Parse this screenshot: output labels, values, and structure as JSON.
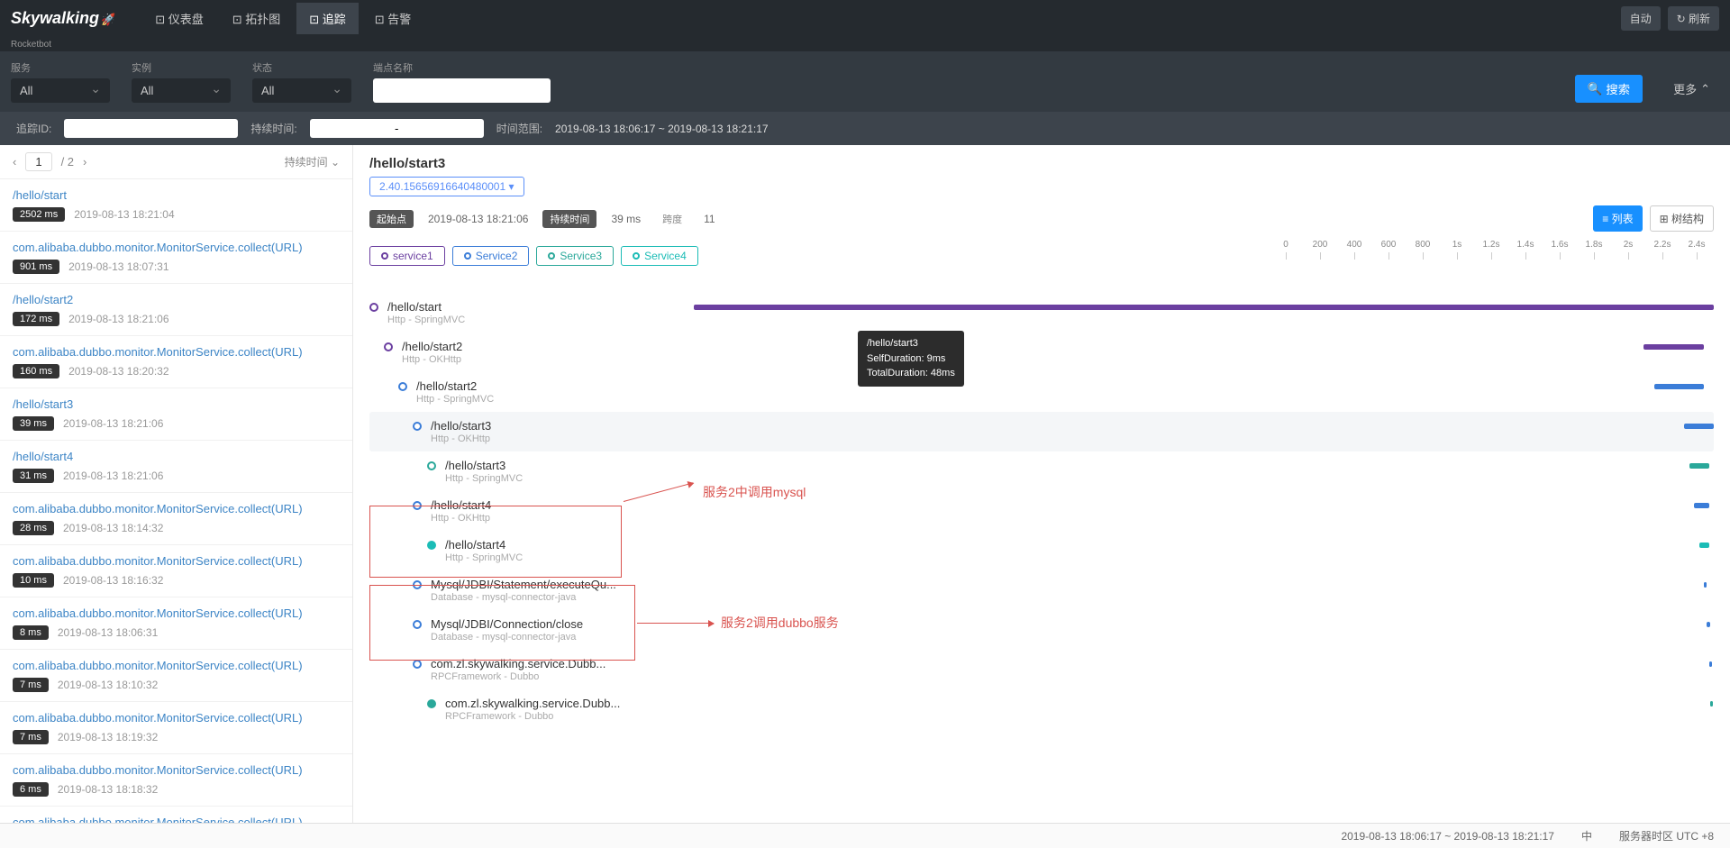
{
  "brand": {
    "name": "Skywalking",
    "sub": "Rocketbot"
  },
  "nav": [
    {
      "label": "仪表盘"
    },
    {
      "label": "拓扑图"
    },
    {
      "label": "追踪",
      "active": true
    },
    {
      "label": "告警"
    }
  ],
  "headerBtns": {
    "auto": "自动",
    "refresh": "刷新"
  },
  "filters": {
    "serviceLabel": "服务",
    "serviceVal": "All",
    "instanceLabel": "实例",
    "instanceVal": "All",
    "statusLabel": "状态",
    "statusVal": "All",
    "endpointLabel": "端点名称",
    "endpointVal": "",
    "searchLabel": "搜索",
    "moreLabel": "更多"
  },
  "subFilter": {
    "traceIdLabel": "追踪ID:",
    "traceIdVal": "",
    "durationLabel": "持续时间:",
    "durationVal": "-",
    "rangeLabel": "时间范围:",
    "rangeVal": "2019-08-13 18:06:17 ~ 2019-08-13 18:21:17"
  },
  "pager": {
    "cur": "1",
    "total": "/ 2",
    "sort": "持续时间"
  },
  "traceList": [
    {
      "name": "/hello/start",
      "dur": "2502 ms",
      "ts": "2019-08-13 18:21:04"
    },
    {
      "name": "com.alibaba.dubbo.monitor.MonitorService.collect(URL)",
      "dur": "901 ms",
      "ts": "2019-08-13 18:07:31"
    },
    {
      "name": "/hello/start2",
      "dur": "172 ms",
      "ts": "2019-08-13 18:21:06"
    },
    {
      "name": "com.alibaba.dubbo.monitor.MonitorService.collect(URL)",
      "dur": "160 ms",
      "ts": "2019-08-13 18:20:32"
    },
    {
      "name": "/hello/start3",
      "dur": "39 ms",
      "ts": "2019-08-13 18:21:06"
    },
    {
      "name": "/hello/start4",
      "dur": "31 ms",
      "ts": "2019-08-13 18:21:06"
    },
    {
      "name": "com.alibaba.dubbo.monitor.MonitorService.collect(URL)",
      "dur": "28 ms",
      "ts": "2019-08-13 18:14:32"
    },
    {
      "name": "com.alibaba.dubbo.monitor.MonitorService.collect(URL)",
      "dur": "10 ms",
      "ts": "2019-08-13 18:16:32"
    },
    {
      "name": "com.alibaba.dubbo.monitor.MonitorService.collect(URL)",
      "dur": "8 ms",
      "ts": "2019-08-13 18:06:31"
    },
    {
      "name": "com.alibaba.dubbo.monitor.MonitorService.collect(URL)",
      "dur": "7 ms",
      "ts": "2019-08-13 18:10:32"
    },
    {
      "name": "com.alibaba.dubbo.monitor.MonitorService.collect(URL)",
      "dur": "7 ms",
      "ts": "2019-08-13 18:19:32"
    },
    {
      "name": "com.alibaba.dubbo.monitor.MonitorService.collect(URL)",
      "dur": "6 ms",
      "ts": "2019-08-13 18:18:32"
    },
    {
      "name": "com.alibaba.dubbo.monitor.MonitorService.collect(URL)",
      "dur": "",
      "ts": ""
    }
  ],
  "trace": {
    "title": "/hello/start3",
    "id": "2.40.15656916640480001",
    "startLabel": "起始点",
    "startVal": "2019-08-13 18:21:06",
    "durLabel": "持续时间",
    "durVal": "39 ms",
    "spanLabel": "跨度",
    "spanVal": "11",
    "listBtn": "列表",
    "treeBtn": "树结构"
  },
  "services": [
    {
      "name": "service1",
      "color": "purple"
    },
    {
      "name": "Service2",
      "color": "blue"
    },
    {
      "name": "Service3",
      "color": "teal"
    },
    {
      "name": "Service4",
      "color": "cyan"
    }
  ],
  "scale": [
    "0",
    "200",
    "400",
    "600",
    "800",
    "1s",
    "1.2s",
    "1.4s",
    "1.6s",
    "1.8s",
    "2s",
    "2.2s",
    "2.4s"
  ],
  "spans": [
    {
      "indent": 0,
      "name": "/hello/start",
      "sub": "Http - SpringMVC",
      "color": "purple",
      "open": true,
      "barL": 0,
      "barW": 100,
      "barC": "purple"
    },
    {
      "indent": 1,
      "name": "/hello/start2",
      "sub": "Http - OKHttp",
      "color": "purple",
      "open": true,
      "barL": 93,
      "barW": 6,
      "barC": "purple"
    },
    {
      "indent": 2,
      "name": "/hello/start2",
      "sub": "Http - SpringMVC",
      "color": "blue",
      "open": true,
      "barL": 94,
      "barW": 5,
      "barC": "blue"
    },
    {
      "indent": 3,
      "name": "/hello/start3",
      "sub": "Http - OKHttp",
      "color": "blue",
      "open": true,
      "barL": 97,
      "barW": 3,
      "barC": "blue",
      "hover": true
    },
    {
      "indent": 4,
      "name": "/hello/start3",
      "sub": "Http - SpringMVC",
      "color": "teal",
      "open": true,
      "barL": 97.5,
      "barW": 2,
      "barC": "teal"
    },
    {
      "indent": 3,
      "name": "/hello/start4",
      "sub": "Http - OKHttp",
      "color": "blue",
      "open": true,
      "barL": 98,
      "barW": 1.5,
      "barC": "blue"
    },
    {
      "indent": 4,
      "name": "/hello/start4",
      "sub": "Http - SpringMVC",
      "color": "cyan",
      "open": false,
      "barL": 98.5,
      "barW": 1,
      "barC": "cyan"
    },
    {
      "indent": 3,
      "name": "Mysql/JDBI/Statement/executeQu...",
      "sub": "Database - mysql-connector-java",
      "color": "blue",
      "open": true,
      "barL": 99,
      "barW": 0.3,
      "barC": "blue"
    },
    {
      "indent": 3,
      "name": "Mysql/JDBI/Connection/close",
      "sub": "Database - mysql-connector-java",
      "color": "blue",
      "open": true,
      "barL": 99.3,
      "barW": 0.3,
      "barC": "blue"
    },
    {
      "indent": 3,
      "name": "com.zl.skywalking.service.Dubb...",
      "sub": "RPCFramework - Dubbo",
      "color": "blue",
      "open": true,
      "barL": 99.5,
      "barW": 0.3,
      "barC": "blue"
    },
    {
      "indent": 4,
      "name": "com.zl.skywalking.service.Dubb...",
      "sub": "RPCFramework - Dubbo",
      "color": "teal",
      "open": false,
      "barL": 99.6,
      "barW": 0.3,
      "barC": "teal"
    }
  ],
  "tooltip": {
    "title": "/hello/start3",
    "l1": "SelfDuration: 9ms",
    "l2": "TotalDuration: 48ms"
  },
  "annotations": {
    "mysql": "服务2中调用mysql",
    "dubbo": "服务2调用dubbo服务"
  },
  "footer": {
    "range": "2019-08-13 18:06:17 ~ 2019-08-13 18:21:17",
    "lang": "中",
    "tz": "服务器时区 UTC +8"
  }
}
